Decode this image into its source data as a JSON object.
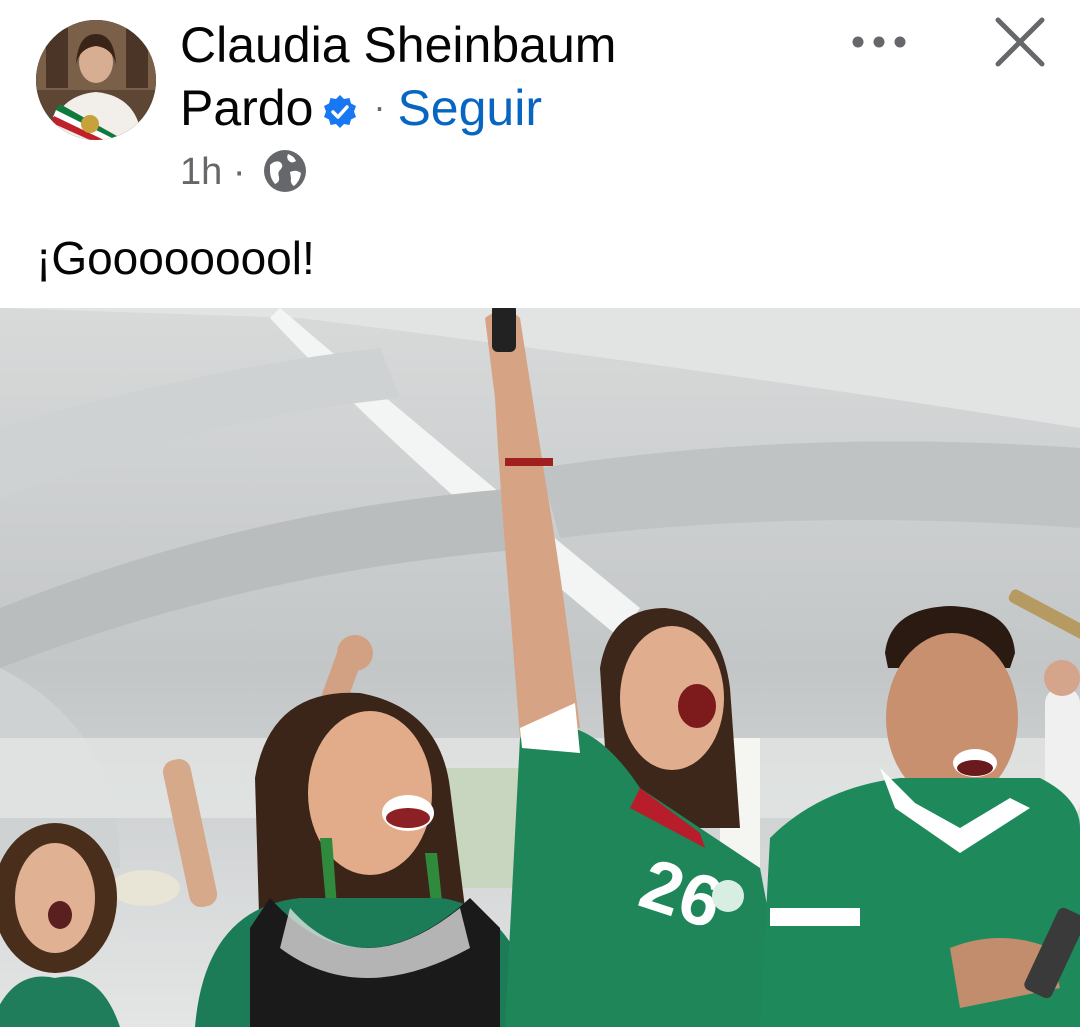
{
  "post": {
    "author": "Claudia Sheinbaum Pardo",
    "follow_label": "Seguir",
    "time": "1h",
    "separator": "·",
    "text": "¡Gooooooool!",
    "audience_icon": "globe-icon",
    "verified_icon": "verified-badge-icon"
  },
  "actions": {
    "more_icon": "more-options-icon",
    "close_icon": "close-icon"
  },
  "colors": {
    "link": "#0866c2",
    "secondary_text": "#65676b",
    "verified": "#1877f2"
  }
}
